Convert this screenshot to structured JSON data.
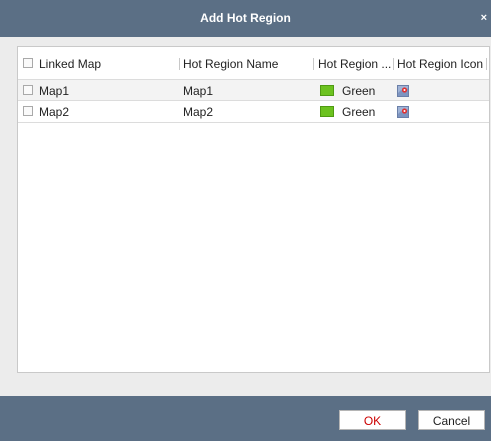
{
  "dialog": {
    "title": "Add Hot Region",
    "close_glyph": "×"
  },
  "table": {
    "columns": [
      "Linked Map",
      "Hot Region Name",
      "Hot Region ...",
      "Hot Region Icon"
    ],
    "rows": [
      {
        "linked_map": "Map1",
        "name": "Map1",
        "color_label": "Green",
        "color": "#6cc21f",
        "icon": "map-icon",
        "checked": false
      },
      {
        "linked_map": "Map2",
        "name": "Map2",
        "color_label": "Green",
        "color": "#6cc21f",
        "icon": "map-icon",
        "checked": false
      }
    ]
  },
  "buttons": {
    "ok": "OK",
    "cancel": "Cancel"
  },
  "colors": {
    "titlebar": "#5b6f85",
    "ok_text": "#cc0000",
    "green": "#6cc21f"
  }
}
